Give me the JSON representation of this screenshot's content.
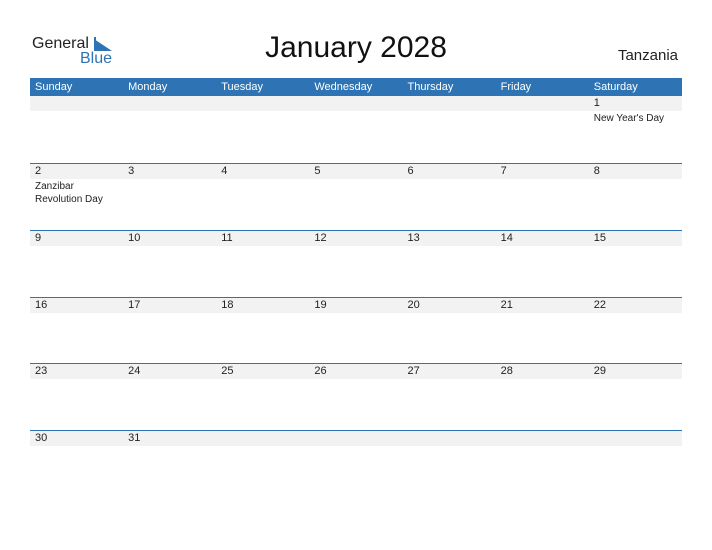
{
  "logo": {
    "part1": "General",
    "part2": "Blue"
  },
  "title": "January 2028",
  "country": "Tanzania",
  "weekdays": [
    "Sunday",
    "Monday",
    "Tuesday",
    "Wednesday",
    "Thursday",
    "Friday",
    "Saturday"
  ],
  "weeks": [
    [
      {
        "day": "",
        "holiday": ""
      },
      {
        "day": "",
        "holiday": ""
      },
      {
        "day": "",
        "holiday": ""
      },
      {
        "day": "",
        "holiday": ""
      },
      {
        "day": "",
        "holiday": ""
      },
      {
        "day": "",
        "holiday": ""
      },
      {
        "day": "1",
        "holiday": "New Year's Day"
      }
    ],
    [
      {
        "day": "2",
        "holiday": "Zanzibar Revolution Day"
      },
      {
        "day": "3",
        "holiday": ""
      },
      {
        "day": "4",
        "holiday": ""
      },
      {
        "day": "5",
        "holiday": ""
      },
      {
        "day": "6",
        "holiday": ""
      },
      {
        "day": "7",
        "holiday": ""
      },
      {
        "day": "8",
        "holiday": ""
      }
    ],
    [
      {
        "day": "9",
        "holiday": ""
      },
      {
        "day": "10",
        "holiday": ""
      },
      {
        "day": "11",
        "holiday": ""
      },
      {
        "day": "12",
        "holiday": ""
      },
      {
        "day": "13",
        "holiday": ""
      },
      {
        "day": "14",
        "holiday": ""
      },
      {
        "day": "15",
        "holiday": ""
      }
    ],
    [
      {
        "day": "16",
        "holiday": ""
      },
      {
        "day": "17",
        "holiday": ""
      },
      {
        "day": "18",
        "holiday": ""
      },
      {
        "day": "19",
        "holiday": ""
      },
      {
        "day": "20",
        "holiday": ""
      },
      {
        "day": "21",
        "holiday": ""
      },
      {
        "day": "22",
        "holiday": ""
      }
    ],
    [
      {
        "day": "23",
        "holiday": ""
      },
      {
        "day": "24",
        "holiday": ""
      },
      {
        "day": "25",
        "holiday": ""
      },
      {
        "day": "26",
        "holiday": ""
      },
      {
        "day": "27",
        "holiday": ""
      },
      {
        "day": "28",
        "holiday": ""
      },
      {
        "day": "29",
        "holiday": ""
      }
    ],
    [
      {
        "day": "30",
        "holiday": ""
      },
      {
        "day": "31",
        "holiday": ""
      },
      {
        "day": "",
        "holiday": ""
      },
      {
        "day": "",
        "holiday": ""
      },
      {
        "day": "",
        "holiday": ""
      },
      {
        "day": "",
        "holiday": ""
      },
      {
        "day": "",
        "holiday": ""
      }
    ]
  ],
  "colors": {
    "accent": "#2e74b5",
    "row_bg": "#f2f2f2"
  }
}
